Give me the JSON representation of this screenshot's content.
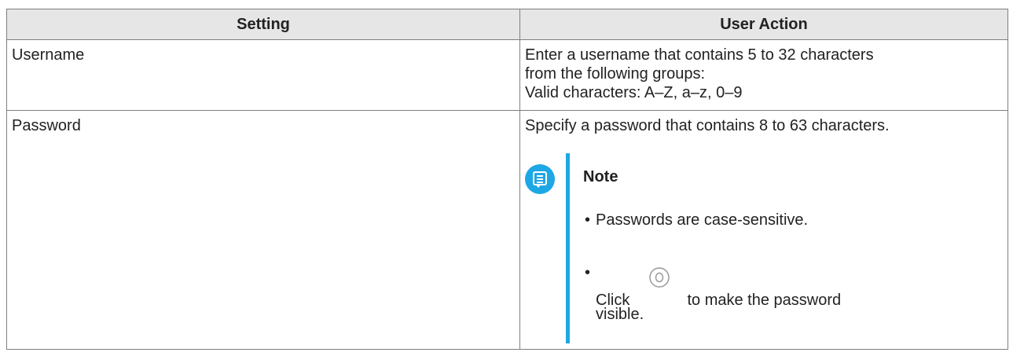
{
  "table": {
    "headers": [
      "Setting",
      "User Action"
    ],
    "rows": {
      "username": {
        "setting": "Username",
        "action_lines": [
          "Enter a username that contains 5 to 32 characters",
          "from the following groups:",
          "Valid characters: A–Z, a–z, 0–9"
        ]
      },
      "password": {
        "setting": "Password",
        "action_intro": "Specify a password that contains 8 to 63 characters.",
        "note": {
          "icon": "note-icon",
          "title": "Note",
          "items": {
            "case": "Passwords are case-sensitive.",
            "click_prefix": "Click",
            "click_icon": "eye-icon",
            "click_suffix": "to make the password",
            "click_end": "visible."
          }
        }
      }
    }
  },
  "colors": {
    "header_bg": "#e6e6e6",
    "border": "#7f7f7f",
    "note_accent": "#1ea7e5"
  }
}
